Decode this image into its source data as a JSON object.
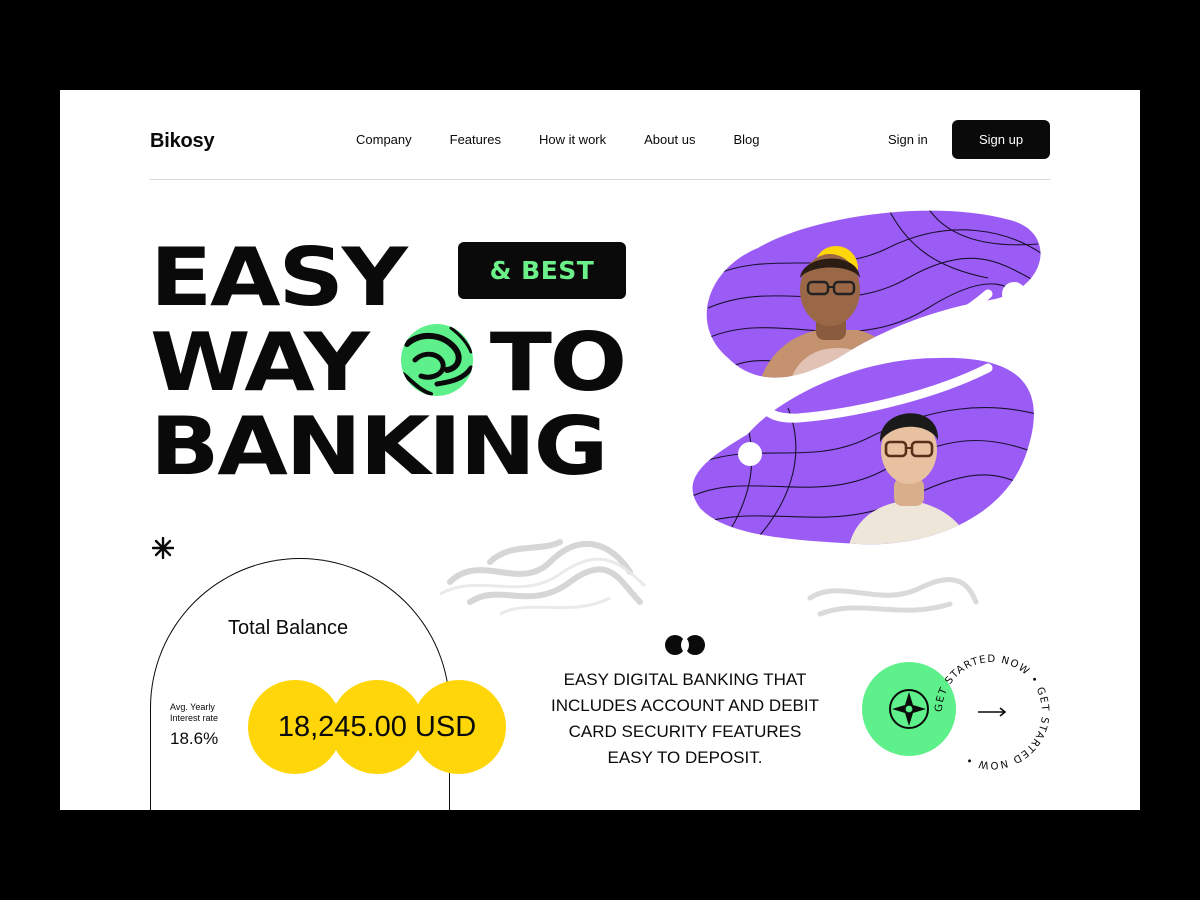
{
  "brand": "Bikosy",
  "nav": {
    "items": [
      "Company",
      "Features",
      "How it work",
      "About us",
      "Blog"
    ],
    "signin": "Sign in",
    "signup": "Sign up"
  },
  "hero": {
    "line1": "EASY",
    "tag": "& BEST",
    "line2a": "WAY",
    "line2b": "TO",
    "line3": "BANKING"
  },
  "balance": {
    "title": "Total Balance",
    "rate_label": "Avg. Yearly Interest rate",
    "rate_value": "18.6%",
    "amount": "18,245.00 USD"
  },
  "feature": {
    "text": "EASY DIGITAL BANKING THAT INCLUDES ACCOUNT AND DEBIT CARD SECURITY FEATURES  EASY TO DEPOSIT."
  },
  "cta": {
    "ring_text": "GET STARTED NOW • GET STARTED NOW •",
    "arrow_icon": "arrow-right-icon"
  },
  "colors": {
    "purple": "#9b5cf6",
    "green": "#5ef08a",
    "yellow": "#ffd60a",
    "black": "#0a0a0a"
  }
}
